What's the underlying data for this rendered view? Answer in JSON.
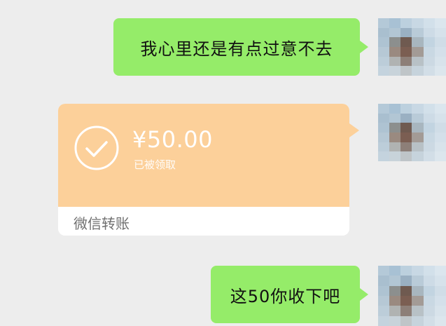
{
  "messages": [
    {
      "type": "text",
      "side": "right",
      "text": "我心里还是有点过意不去"
    },
    {
      "type": "transfer",
      "side": "right",
      "amount": "¥50.00",
      "status": "已被领取",
      "label": "微信转账",
      "icon": "checkmark-circle-icon"
    },
    {
      "type": "text",
      "side": "right",
      "text": "这50你收下吧"
    }
  ],
  "colors": {
    "background": "#ededed",
    "sent_bubble": "#95ec69",
    "transfer_card": "#fcd09a",
    "transfer_footer": "#ffffff"
  },
  "avatar": {
    "description_icon": "pixelated-avatar-icon"
  }
}
